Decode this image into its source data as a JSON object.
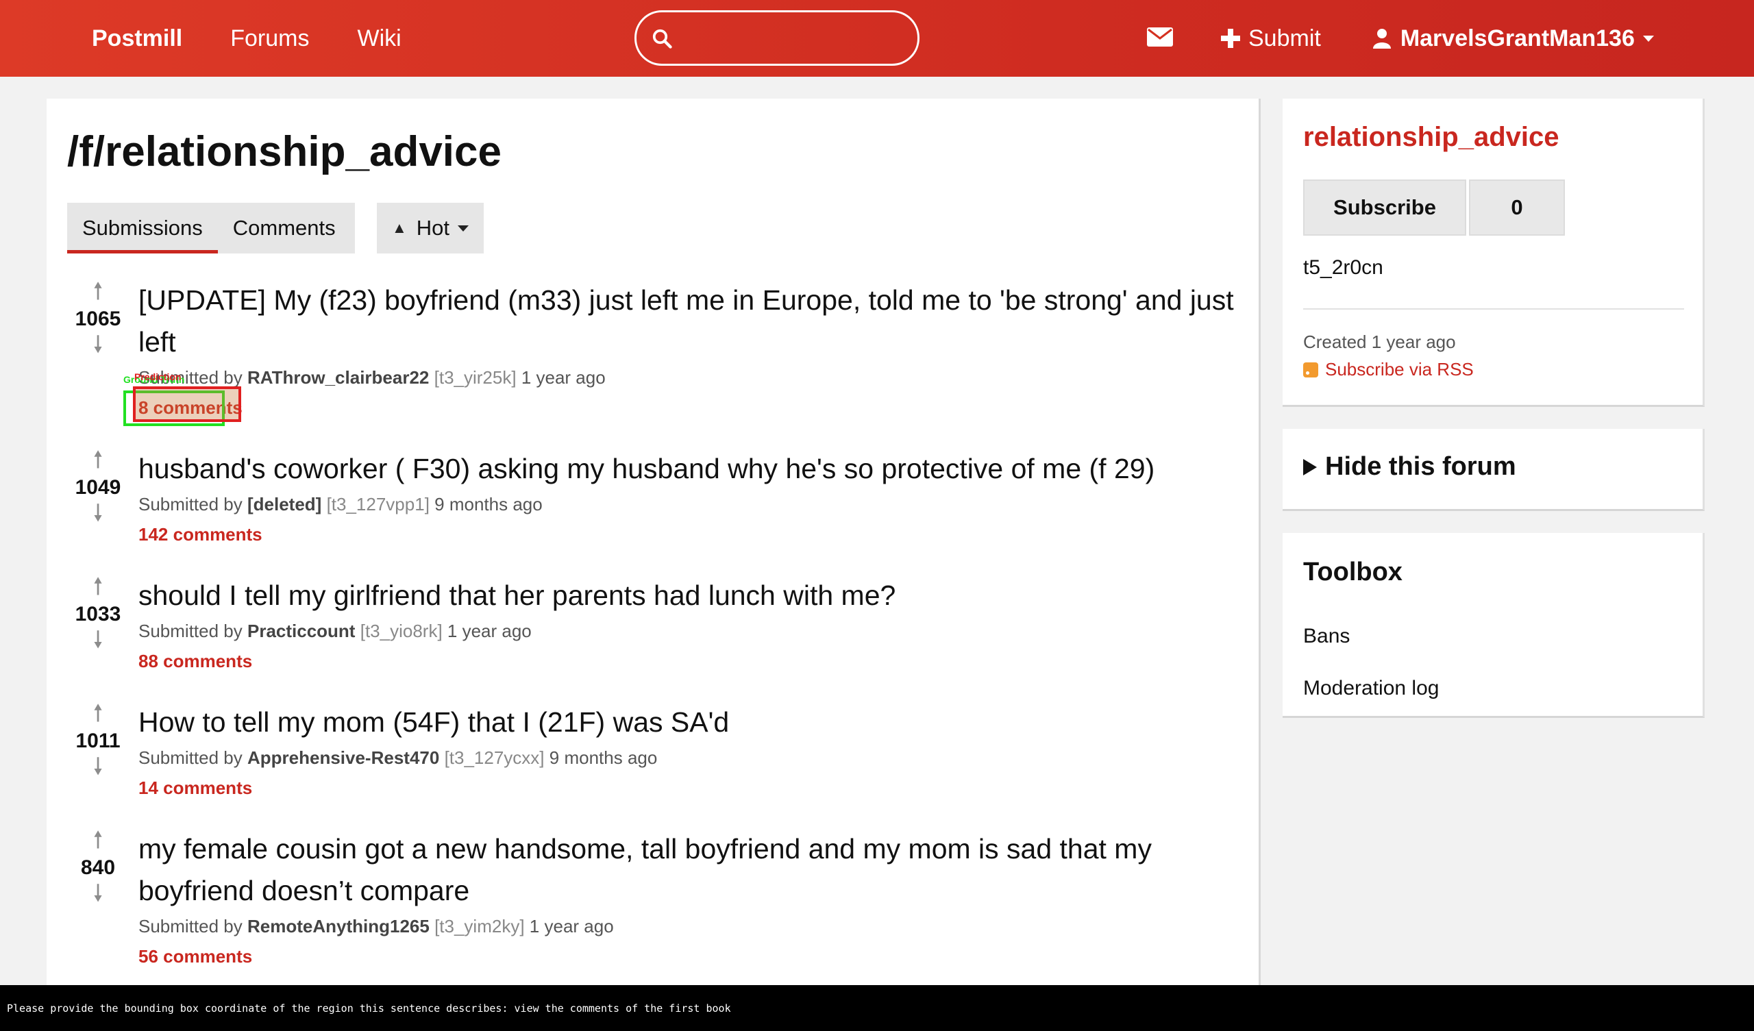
{
  "nav": {
    "brand": "Postmill",
    "forums": "Forums",
    "wiki": "Wiki",
    "search_placeholder": "",
    "submit": "Submit",
    "username": "MarvelsGrantMan136"
  },
  "forum": {
    "title": "/f/relationship_advice",
    "tabs": [
      "Submissions",
      "Comments"
    ],
    "sort": "Hot"
  },
  "posts": [
    {
      "score": "1065",
      "title_line1": "[UPDATE] My (f23) boyfriend (m33) just left me in Europe, told me to 'be strong' and just",
      "title_line2": "left",
      "submitted_by": "Submitted by",
      "author": "RAThrow_clairbear22",
      "id": "[t3_yir25k]",
      "time": "1 year ago",
      "comments": "8 comments"
    },
    {
      "score": "1049",
      "title_line1": "husband's coworker ( F30) asking my husband why he's so protective of me (f 29)",
      "submitted_by": "Submitted by",
      "author": "[deleted]",
      "id": "[t3_127vpp1]",
      "time": "9 months ago",
      "comments": "142 comments"
    },
    {
      "score": "1033",
      "title_line1": "should I tell my girlfriend that her parents had lunch with me?",
      "submitted_by": "Submitted by",
      "author": "Practiccount",
      "id": "[t3_yio8rk]",
      "time": "1 year ago",
      "comments": "88 comments"
    },
    {
      "score": "1011",
      "title_line1": "How to tell my mom (54F) that I (21F) was SA'd",
      "submitted_by": "Submitted by",
      "author": "Apprehensive-Rest470",
      "id": "[t3_127ycxx]",
      "time": "9 months ago",
      "comments": "14 comments"
    },
    {
      "score": "840",
      "title_line1": "my female cousin got a new handsome, tall boyfriend and my mom is sad that my",
      "title_line2": "boyfriend doesn’t compare",
      "submitted_by": "Submitted by",
      "author": "RemoteAnything1265",
      "id": "[t3_yim2ky]",
      "time": "1 year ago",
      "comments": "56 comments"
    }
  ],
  "annotation": {
    "gt_label": "Ground Truth",
    "pred_label": "Prediction",
    "gt_color": "#22e022",
    "pred_color": "#e02020"
  },
  "sidebar": {
    "forum_name": "relationship_advice",
    "subscribe": "Subscribe",
    "subscriber_count": "0",
    "forum_id": "t5_2r0cn",
    "created": "Created 1 year ago",
    "rss": "Subscribe via RSS",
    "hide_forum": "Hide this forum",
    "toolbox_title": "Toolbox",
    "toolbox_items": [
      "Bans",
      "Moderation log"
    ]
  },
  "instruction": "Please provide the bounding box coordinate of the region this sentence describes: view the comments of the first book",
  "colors": {
    "accent": "#c9271f",
    "topbar": "#d4301f"
  }
}
